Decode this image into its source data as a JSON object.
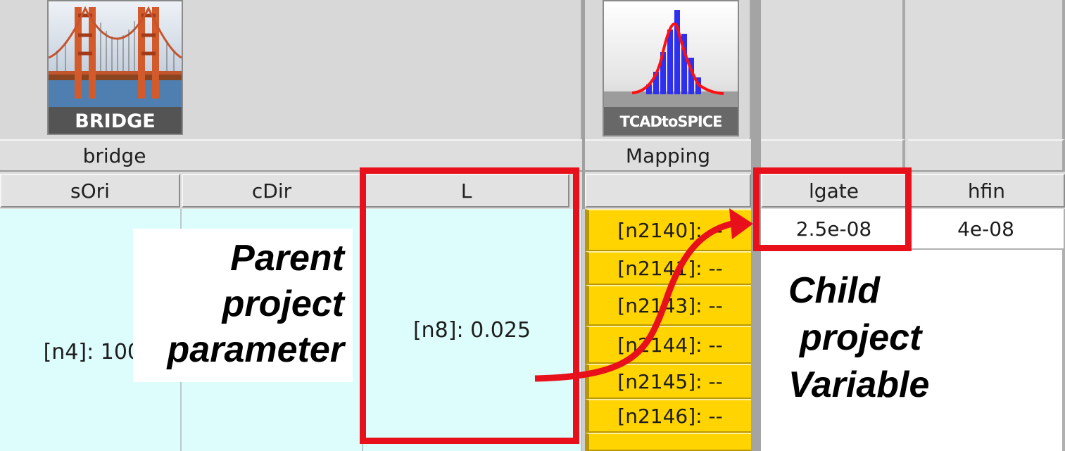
{
  "tools": {
    "bridge": {
      "logo_caption": "BRIDGE",
      "name": "bridge"
    },
    "mapping": {
      "logo_caption": "TCADtoSPICE",
      "name": "Mapping"
    }
  },
  "columns": {
    "sOri": "sOri",
    "cDir": "cDir",
    "L": "L",
    "lgate": "lgate",
    "hfin": "hfin"
  },
  "cells": {
    "sOri_value": "[n4]: 100",
    "L_value": "[n8]: 0.025",
    "lgate_value": "2.5e-08",
    "hfin_value": "4e-08"
  },
  "mapping_nodes": [
    "[n2140]: --",
    "[n2141]: --",
    "[n2143]: --",
    "[n2144]: --",
    "[n2145]: --",
    "[n2146]: --"
  ],
  "annotations": {
    "parent": [
      "Parent",
      "project",
      "parameter"
    ],
    "child": [
      "Child",
      "project",
      "Variable"
    ],
    "highlight_color": "#e8101a"
  },
  "icons": [
    "golden-gate-bridge-icon",
    "histogram-icon"
  ]
}
